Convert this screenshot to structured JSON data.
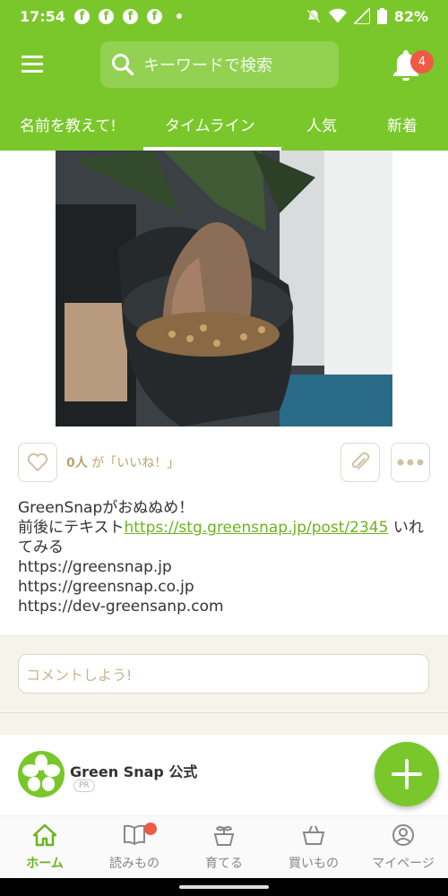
{
  "status_bar": {
    "time": "17:54",
    "battery": "82%",
    "icons": [
      "facebook-icon",
      "facebook-icon",
      "facebook-icon",
      "facebook-icon",
      "mute-icon",
      "wifi-icon",
      "signal-icon",
      "battery-icon"
    ]
  },
  "header": {
    "search_placeholder": "キーワードで検索",
    "notification_count": "4"
  },
  "tabs": [
    "名前を教えて!",
    "タイムライン",
    "人気",
    "新着"
  ],
  "active_tab": "タイムライン",
  "post": {
    "likes_count": "0人",
    "likes_suffix": "が「いいね！」",
    "text_line1": "GreenSnapがおぬぬめ！",
    "text_prefix": "前後にテキスト",
    "text_link": "https://stg.greensnap.jp/post/2345",
    "text_suffix": " いれてみる",
    "url1": "https://greensnap.jp",
    "url2": "https://greensnap.co.jp",
    "url3": "https://dev-greensanp.com"
  },
  "comment": {
    "placeholder": "コメントしよう!"
  },
  "account": {
    "name": "Green Snap 公式",
    "tag": "PR"
  },
  "bottom_nav": [
    "ホーム",
    "読みもの",
    "育てる",
    "買いもの",
    "マイページ"
  ],
  "colors": {
    "brand_green": "#7ac72b",
    "link_green": "#6cb31f",
    "badge_red": "#ef5a45"
  }
}
